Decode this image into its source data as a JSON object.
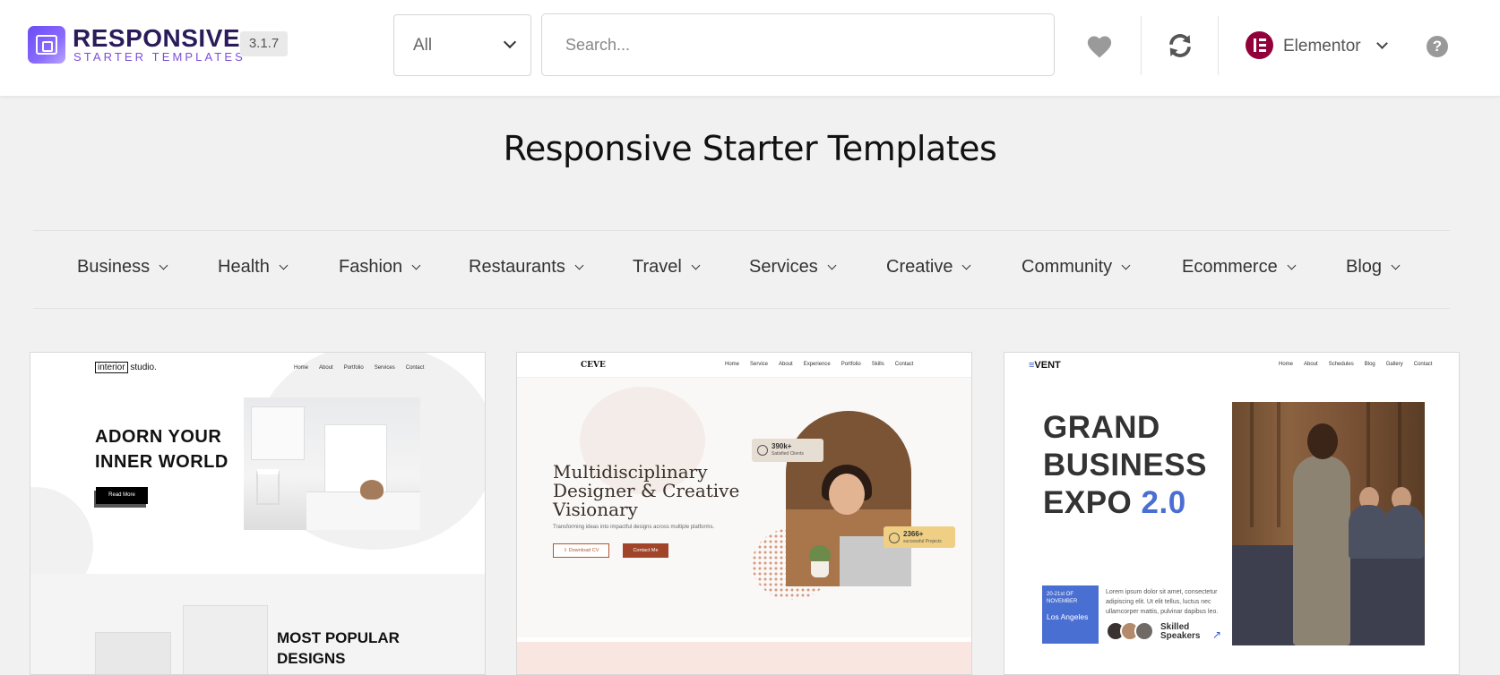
{
  "header": {
    "logo_title": "RESPONSIVE",
    "logo_subtitle": "STARTER TEMPLATES",
    "version": "3.1.7",
    "filter_select": {
      "value": "All"
    },
    "search": {
      "placeholder": "Search...",
      "value": ""
    },
    "builder": {
      "label": "Elementor"
    },
    "help_label": "?"
  },
  "page_title": "Responsive Starter Templates",
  "categories": [
    "Business",
    "Health",
    "Fashion",
    "Restaurants",
    "Travel",
    "Services",
    "Creative",
    "Community",
    "Ecommerce",
    "Blog"
  ],
  "cards": [
    {
      "logo_boxed": "interior",
      "logo_rest": " studio.",
      "nav": [
        "Home",
        "About",
        "Portfolio",
        "Services",
        "Contact"
      ],
      "heading_line1": "ADORN YOUR",
      "heading_line2": "INNER WORLD",
      "button": "Read More",
      "section_heading_line1": "MOST POPULAR",
      "section_heading_line2": "DESIGNS"
    },
    {
      "logo": "CEVE",
      "nav": [
        "Home",
        "Service",
        "About",
        "Experience",
        "Portfolio",
        "Skills",
        "Contact"
      ],
      "heading_line1": "Multidisciplinary",
      "heading_line2": "Designer & Creative",
      "heading_line3": "Visionary",
      "subtitle": "Transforming ideas into impactful designs across multiple platforms.",
      "button1": "⇩ Download CV",
      "button2": "Contact Me",
      "badge1_num": "390k+",
      "badge1_text": "Satisfied Clients",
      "badge2_num": "2366+",
      "badge2_text": "successful Projects"
    },
    {
      "logo_mark": "≡",
      "logo_text": "VENT",
      "nav": [
        "Home",
        "About",
        "Schedules",
        "Blog",
        "Gallery",
        "Contact"
      ],
      "heading_line1": "GRAND",
      "heading_line2": "BUSINESS",
      "heading_line3": "EXPO",
      "heading_accent": "2.0",
      "date": "20-21st OF NOVEMBER",
      "city": "Los Angeles",
      "description": "Lorem ipsum dolor sit amet, consectetur adipiscing elit. Ut elit tellus, luctus nec ullamcorper mattis, pulvinar dapibus leo.",
      "speakers_line1": "Skilled",
      "speakers_line2": "Speakers",
      "arrow": "↗"
    }
  ],
  "colors": {
    "brand_purple": "#6a4cf3",
    "elementor": "#92003b",
    "expo_blue": "#4a6fd2",
    "ceve_accent": "#a0442a"
  },
  "icons": [
    "favorites-heart-icon",
    "sync-icon",
    "elementor-icon",
    "help-icon",
    "chevron-down-icon"
  ]
}
